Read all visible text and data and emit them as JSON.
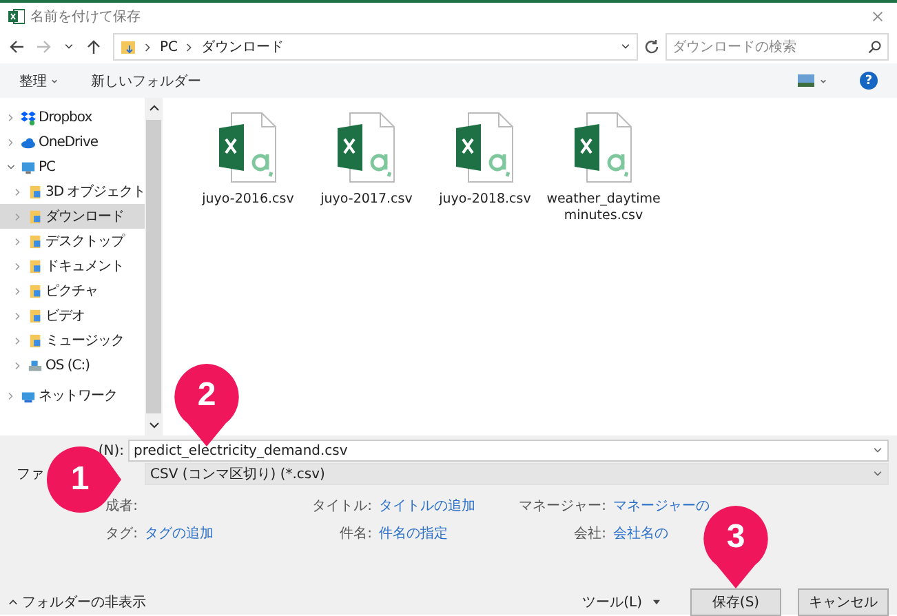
{
  "window": {
    "title": "名前を付けて保存"
  },
  "address": {
    "path": [
      "PC",
      "ダウンロード"
    ],
    "search_placeholder": "ダウンロードの検索"
  },
  "toolbar": {
    "organize": "整理",
    "new_folder": "新しいフォルダー",
    "help": "?"
  },
  "sidebar": {
    "items": [
      {
        "label": "Dropbox",
        "kind": "dropbox",
        "selected": false,
        "expanded": false
      },
      {
        "label": "OneDrive",
        "kind": "cloud",
        "selected": false,
        "expanded": false
      },
      {
        "label": "PC",
        "kind": "pc",
        "selected": false,
        "expanded": true,
        "children": [
          {
            "label": "3D オブジェクト",
            "kind": "folder",
            "selected": false,
            "expanded": false
          },
          {
            "label": "ダウンロード",
            "kind": "folder",
            "selected": true,
            "expanded": false
          },
          {
            "label": "デスクトップ",
            "kind": "folder",
            "selected": false,
            "expanded": false
          },
          {
            "label": "ドキュメント",
            "kind": "folder",
            "selected": false,
            "expanded": false
          },
          {
            "label": "ピクチャ",
            "kind": "folder",
            "selected": false,
            "expanded": false
          },
          {
            "label": "ビデオ",
            "kind": "folder",
            "selected": false,
            "expanded": false
          },
          {
            "label": "ミュージック",
            "kind": "folder",
            "selected": false,
            "expanded": false
          },
          {
            "label": "OS (C:)",
            "kind": "drive",
            "selected": false,
            "expanded": false
          }
        ]
      },
      {
        "label": "ネットワーク",
        "kind": "network",
        "selected": false,
        "expanded": false
      }
    ]
  },
  "files": [
    {
      "lines": [
        "juyo-2016.csv"
      ]
    },
    {
      "lines": [
        "juyo-2017.csv"
      ]
    },
    {
      "lines": [
        "juyo-2018.csv"
      ]
    },
    {
      "lines": [
        "weather_daytime",
        "minutes.csv"
      ]
    }
  ],
  "form": {
    "filename_label": "(N):",
    "filename": "predict_electricity_demand.csv",
    "type_label": "ファ",
    "type": "CSV (コンマ区切り) (*.csv)"
  },
  "meta": [
    {
      "label": "成者:"
    },
    {
      "label": "タイトル:",
      "value": "タイトルの追加"
    },
    {
      "label": "マネージャー:",
      "value": "マネージャーの"
    },
    {
      "label": "タグ:",
      "value": "タグの追加"
    },
    {
      "label": "件名:",
      "value": "件名の指定"
    },
    {
      "label": "会社:",
      "value": "会社名の"
    }
  ],
  "footer": {
    "hide_folders": "フォルダーの非表示",
    "tools": "ツール(L)",
    "buttons": [
      "保存(S)",
      "キャンセル"
    ]
  },
  "markers": [
    "1",
    "2",
    "3"
  ]
}
